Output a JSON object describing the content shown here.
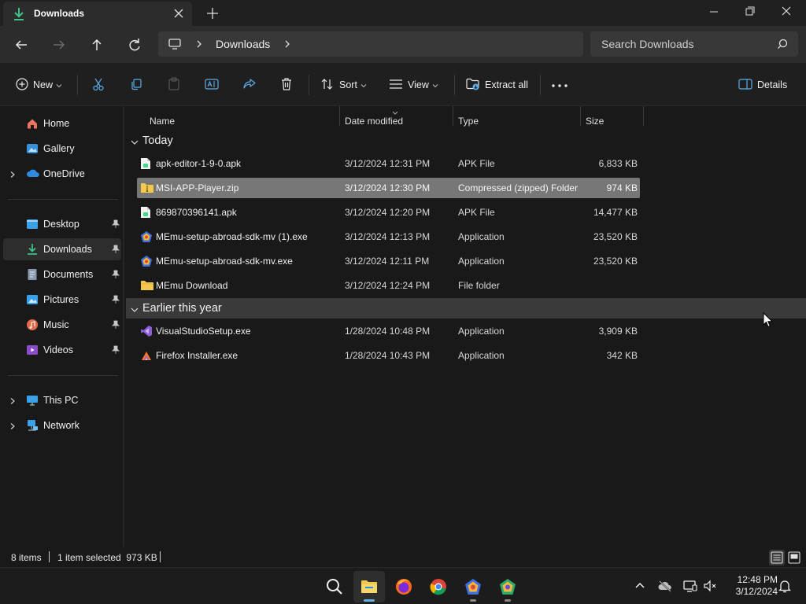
{
  "window": {
    "tab_title": "Downloads",
    "controls": [
      "minimize",
      "maximize",
      "close"
    ]
  },
  "navigation": {
    "breadcrumb": [
      "Downloads"
    ],
    "search_placeholder": "Search Downloads"
  },
  "commandbar": {
    "new_label": "New",
    "sort_label": "Sort",
    "view_label": "View",
    "extract_label": "Extract all",
    "details_label": "Details"
  },
  "sidebar": {
    "items": [
      {
        "label": "Home",
        "icon": "home-icon"
      },
      {
        "label": "Gallery",
        "icon": "gallery-icon"
      },
      {
        "label": "OneDrive",
        "icon": "onedrive-icon"
      },
      {
        "label": "Desktop",
        "icon": "desktop-icon"
      },
      {
        "label": "Downloads",
        "icon": "downloads-icon"
      },
      {
        "label": "Documents",
        "icon": "documents-icon"
      },
      {
        "label": "Pictures",
        "icon": "pictures-icon"
      },
      {
        "label": "Music",
        "icon": "music-icon"
      },
      {
        "label": "Videos",
        "icon": "videos-icon"
      },
      {
        "label": "This PC",
        "icon": "this-pc-icon"
      },
      {
        "label": "Network",
        "icon": "network-icon"
      }
    ]
  },
  "filelist": {
    "columns": [
      "Name",
      "Date modified",
      "Type",
      "Size"
    ],
    "groups": [
      {
        "label": "Today",
        "rows": [
          {
            "name": "apk-editor-1-9-0.apk",
            "date": "3/12/2024 12:31 PM",
            "type": "APK File",
            "size": "6,833 KB",
            "icon": "apk-file-icon"
          },
          {
            "name": "MSI-APP-Player.zip",
            "date": "3/12/2024 12:30 PM",
            "type": "Compressed (zipped) Folder",
            "size": "974 KB",
            "icon": "zip-folder-icon"
          },
          {
            "name": "869870396141.apk",
            "date": "3/12/2024 12:20 PM",
            "type": "APK File",
            "size": "14,477 KB",
            "icon": "apk-file-icon"
          },
          {
            "name": "MEmu-setup-abroad-sdk-mv (1).exe",
            "date": "3/12/2024 12:13 PM",
            "type": "Application",
            "size": "23,520 KB",
            "icon": "memu-app-icon"
          },
          {
            "name": "MEmu-setup-abroad-sdk-mv.exe",
            "date": "3/12/2024 12:11 PM",
            "type": "Application",
            "size": "23,520 KB",
            "icon": "memu-app-icon"
          },
          {
            "name": "MEmu Download",
            "date": "3/12/2024 12:24 PM",
            "type": "File folder",
            "size": "",
            "icon": "folder-icon"
          }
        ]
      },
      {
        "label": "Earlier this year",
        "rows": [
          {
            "name": "VisualStudioSetup.exe",
            "date": "1/28/2024 10:48 PM",
            "type": "Application",
            "size": "3,909 KB",
            "icon": "visual-studio-icon"
          },
          {
            "name": "Firefox Installer.exe",
            "date": "1/28/2024 10:43 PM",
            "type": "Application",
            "size": "342 KB",
            "icon": "firefox-installer-icon"
          }
        ]
      }
    ]
  },
  "status": {
    "count": "8 items",
    "selection": "1 item selected  973 KB"
  },
  "taskbar": {
    "time": "12:48 PM",
    "date": "3/12/2024"
  }
}
